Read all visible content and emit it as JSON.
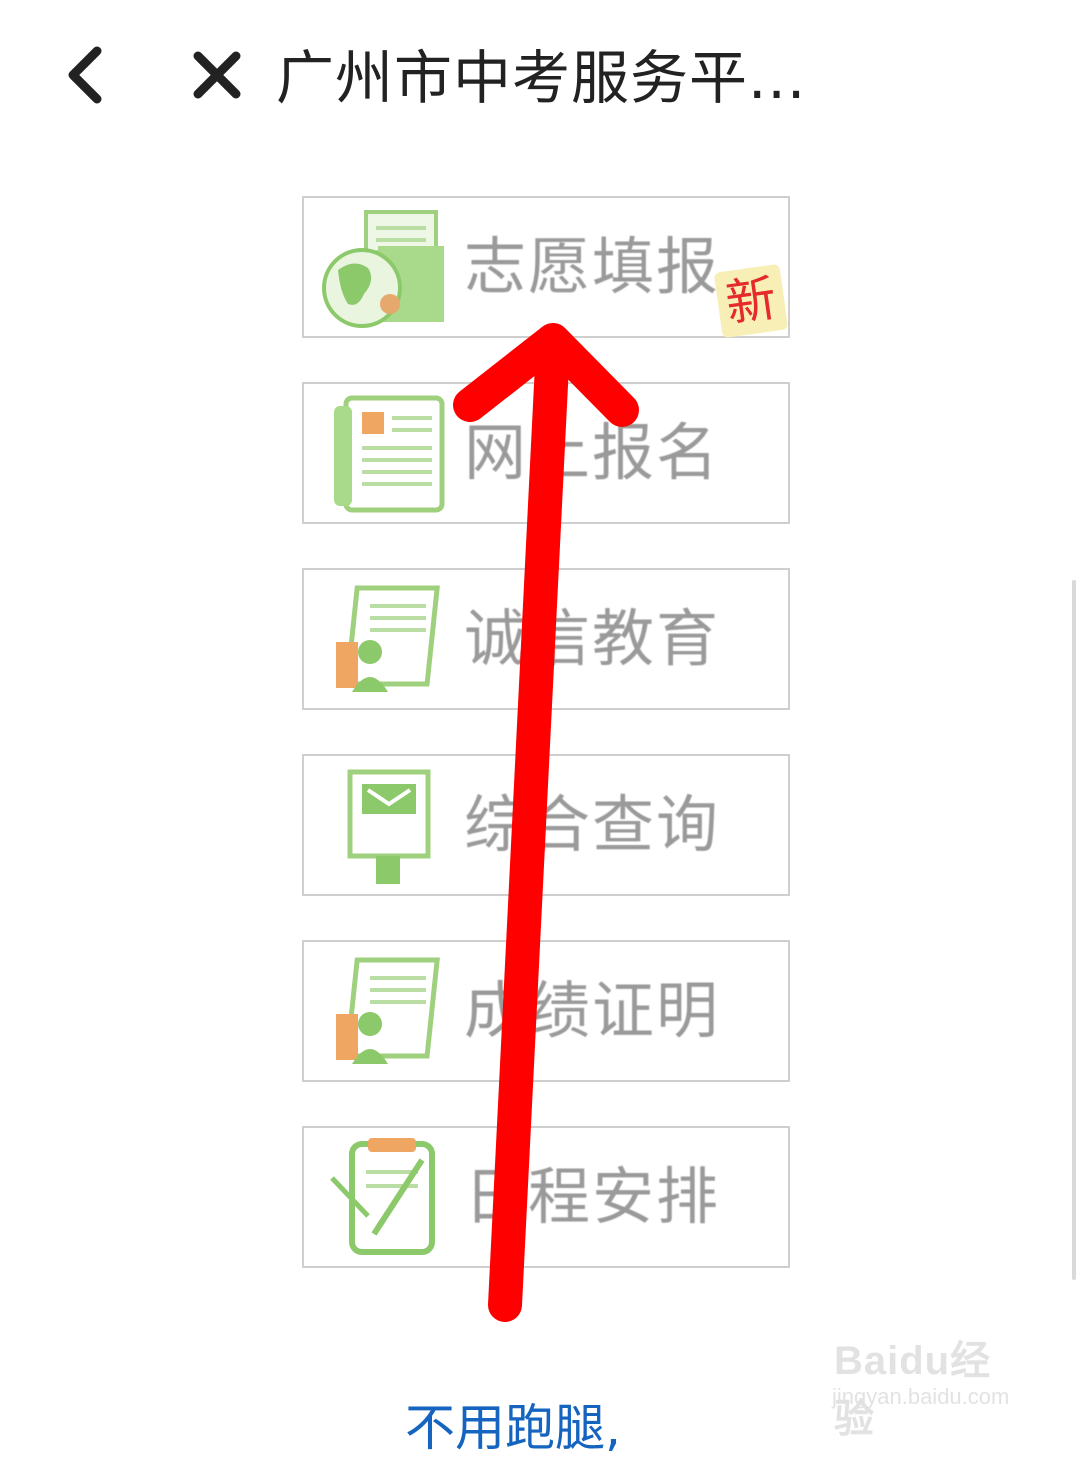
{
  "header": {
    "title": "广州市中考服务平..."
  },
  "menu": {
    "items": [
      {
        "label": "志愿填报",
        "badge": "新"
      },
      {
        "label": "网上报名"
      },
      {
        "label": "诚信教育"
      },
      {
        "label": "综合查询"
      },
      {
        "label": "成绩证明"
      },
      {
        "label": "日程安排"
      }
    ]
  },
  "footer": {
    "link_text": "不用跑腿,"
  },
  "watermark": {
    "brand": "Baidu经验",
    "url": "jingyan.baidu.com"
  },
  "colors": {
    "accent_green": "#8cc96b",
    "arrow_red": "#ff0000",
    "link_blue": "#1565c0"
  }
}
